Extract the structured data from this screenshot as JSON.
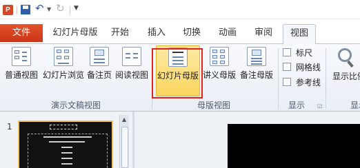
{
  "app": {
    "icon_letter": "P"
  },
  "tabs": [
    {
      "label": "文件",
      "active": false
    },
    {
      "label": "幻灯片母版",
      "active": false
    },
    {
      "label": "开始",
      "active": false
    },
    {
      "label": "插入",
      "active": false
    },
    {
      "label": "切换",
      "active": false
    },
    {
      "label": "动画",
      "active": false
    },
    {
      "label": "审阅",
      "active": false
    },
    {
      "label": "视图",
      "active": true
    }
  ],
  "ribbon": {
    "presentation_views": {
      "group_label": "演示文稿视图",
      "buttons": [
        {
          "label": "普通视图",
          "icon": "normal-view-icon"
        },
        {
          "label": "幻灯片浏览",
          "icon": "slide-sorter-icon"
        },
        {
          "label": "备注页",
          "icon": "notes-page-icon"
        },
        {
          "label": "阅读视图",
          "icon": "reading-view-icon"
        }
      ]
    },
    "master_views": {
      "group_label": "母版视图",
      "buttons": [
        {
          "label": "幻灯片母版",
          "icon": "slide-master-icon",
          "selected": true
        },
        {
          "label": "讲义母版",
          "icon": "handout-master-icon"
        },
        {
          "label": "备注母版",
          "icon": "notes-master-icon"
        }
      ]
    },
    "show": {
      "group_label": "显示",
      "checkboxes": [
        {
          "label": "标尺",
          "checked": false
        },
        {
          "label": "网格线",
          "checked": false
        },
        {
          "label": "参考线",
          "checked": false
        }
      ]
    },
    "zoom": {
      "label": "显示比例",
      "group_label": "显示"
    }
  },
  "slides_pane": {
    "slide_number": "1"
  },
  "colors": {
    "file_tab": "#d24726",
    "highlight": "#fbd65f",
    "annotation_box": "#e2231a"
  }
}
